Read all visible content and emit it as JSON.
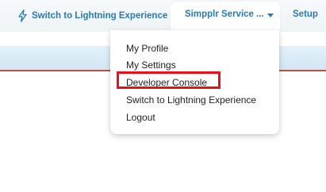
{
  "header": {
    "lightning_link": "Switch to Lightning Experience",
    "user_menu_label": "Simpplr Service ...",
    "setup_link": "Setup"
  },
  "dropdown": {
    "items": [
      {
        "label": "My Profile"
      },
      {
        "label": "My Settings"
      },
      {
        "label": "Developer Console"
      },
      {
        "label": "Switch to Lightning Experience"
      },
      {
        "label": "Logout"
      }
    ],
    "highlighted_item": "Developer Console"
  },
  "colors": {
    "link": "#2a7ab0",
    "highlight_border": "#e8101c",
    "accent_line": "#b7524c"
  },
  "icons": {
    "lightning": "lightning-bolt-icon",
    "user_menu_caret": "caret-down-icon"
  }
}
